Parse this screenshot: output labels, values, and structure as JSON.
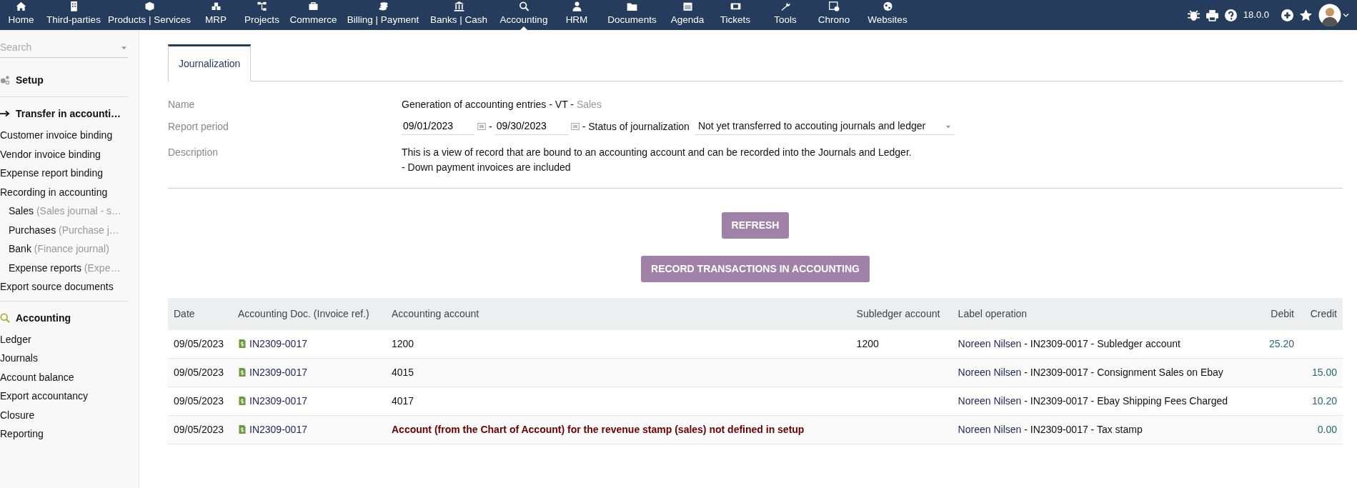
{
  "topnav": {
    "items": [
      {
        "label": "Home",
        "selected": false
      },
      {
        "label": "Third-parties",
        "selected": false
      },
      {
        "label": "Products | Services",
        "selected": false
      },
      {
        "label": "MRP",
        "selected": false
      },
      {
        "label": "Projects",
        "selected": false
      },
      {
        "label": "Commerce",
        "selected": false
      },
      {
        "label": "Billing | Payment",
        "selected": false
      },
      {
        "label": "Banks | Cash",
        "selected": false
      },
      {
        "label": "Accounting",
        "selected": true
      },
      {
        "label": "HRM",
        "selected": false
      },
      {
        "label": "Documents",
        "selected": false
      },
      {
        "label": "Agenda",
        "selected": false
      },
      {
        "label": "Tickets",
        "selected": false
      },
      {
        "label": "Tools",
        "selected": false
      },
      {
        "label": "Chrono",
        "selected": false
      },
      {
        "label": "Websites",
        "selected": false
      }
    ],
    "version": "18.0.0"
  },
  "sidebar": {
    "search": {
      "placeholder": "Search"
    },
    "sections": [
      {
        "title": "Setup"
      },
      {
        "title": "Transfer in accounti…",
        "items": [
          {
            "kind": "link",
            "label": "Customer invoice binding"
          },
          {
            "kind": "link",
            "label": "Vendor invoice binding"
          },
          {
            "kind": "link",
            "label": "Expense report binding"
          },
          {
            "kind": "link",
            "label": "Recording in accounting"
          },
          {
            "kind": "sub",
            "label": "Sales",
            "hint": "(Sales journal - s…"
          },
          {
            "kind": "sub",
            "label": "Purchases",
            "hint": "(Purchase j…"
          },
          {
            "kind": "sub",
            "label": "Bank",
            "hint": "(Finance journal)"
          },
          {
            "kind": "sub",
            "label": "Expense reports",
            "hint": "(Expe…"
          },
          {
            "kind": "link",
            "label": "Export source documents"
          }
        ]
      },
      {
        "title": "Accounting",
        "items": [
          {
            "kind": "link",
            "label": "Ledger"
          },
          {
            "kind": "link",
            "label": "Journals"
          },
          {
            "kind": "link",
            "label": "Account balance"
          },
          {
            "kind": "link",
            "label": "Export accountancy"
          },
          {
            "kind": "link",
            "label": "Closure"
          },
          {
            "kind": "link",
            "label": "Reporting"
          }
        ]
      }
    ]
  },
  "tabs": [
    {
      "label": "Journalization",
      "selected": true
    }
  ],
  "form": {
    "name_label": "Name",
    "name_value": "Generation of accounting entries - VT -",
    "name_journal": "Sales",
    "period_label": "Report period",
    "date_from": "09/01/2023",
    "separator": "-",
    "date_to": "09/30/2023",
    "status_label": "- Status of journalization",
    "status_value": "Not yet transferred to accouting journals and ledger",
    "description_label": "Description",
    "description_lines": [
      "This is a view of record that are bound to an accounting account and can be recorded into the Journals and Ledger.",
      "- Down payment invoices are included"
    ]
  },
  "buttons": [
    "REFRESH",
    "RECORD TRANSACTIONS IN ACCOUNTING"
  ],
  "table": {
    "columns": [
      "Date",
      "Accounting Doc. (Invoice ref.)",
      "Accounting account",
      "Subledger account",
      "Label operation",
      "Debit",
      "Credit"
    ],
    "rows": [
      {
        "date": "09/05/2023",
        "doc": "IN2309-0017",
        "account": "1200",
        "account_error": false,
        "subledger": "1200",
        "party": "Noreen Nilsen",
        "label": " - IN2309-0017 - Subledger account",
        "debit": "25.20",
        "credit": ""
      },
      {
        "date": "09/05/2023",
        "doc": "IN2309-0017",
        "account": "4015",
        "account_error": false,
        "subledger": "",
        "party": "Noreen Nilsen",
        "label": " - IN2309-0017 - Consignment Sales on Ebay",
        "debit": "",
        "credit": "15.00"
      },
      {
        "date": "09/05/2023",
        "doc": "IN2309-0017",
        "account": "4017",
        "account_error": false,
        "subledger": "",
        "party": "Noreen Nilsen",
        "label": " - IN2309-0017 - Ebay Shipping Fees Charged",
        "debit": "",
        "credit": "10.20"
      },
      {
        "date": "09/05/2023",
        "doc": "IN2309-0017",
        "account": "Account (from the Chart of Account) for the revenue stamp (sales) not defined in setup",
        "account_error": true,
        "subledger": "",
        "party": "Noreen Nilsen",
        "label": " - IN2309-0017 - Tax stamp",
        "debit": "",
        "credit": "0.00"
      }
    ]
  }
}
